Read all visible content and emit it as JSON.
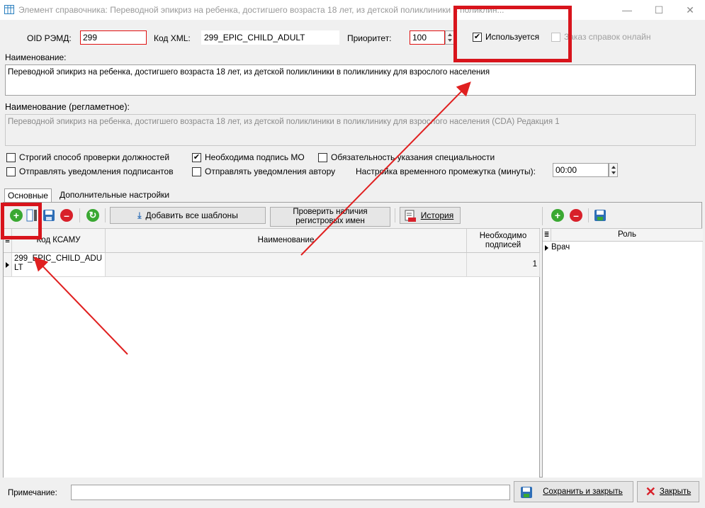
{
  "window": {
    "title": "Элемент справочника: Переводной эпикриз на ребенка, достигшего возраста 18 лет, из детской поликлиники в поликлин...",
    "minimize": "—",
    "maximize": "☐",
    "close": "✕"
  },
  "form": {
    "oid_label": "OID РЭМД:",
    "oid_value": "299",
    "xml_label": "Код XML:",
    "xml_value": "299_EPIC_CHILD_ADULT",
    "priority_label": "Приоритет:",
    "priority_value": "100",
    "used_label": "Используется",
    "used_checked": true,
    "order_online_label": "Заказ справок онлайн",
    "order_online_checked": false,
    "name_label": "Наименование:",
    "name_value": "Переводной эпикриз на ребенка, достигшего возраста 18 лет, из детской поликлиники в поликлинику для взрослого населения",
    "reg_name_label": "Наименование (регламетное):",
    "reg_name_value": "Переводной эпикриз на ребенка, достигшего возраста 18 лет, из детской поликлиники в поликлинику для взрослого населения (CDA) Редакция 1",
    "strict_check_label": "Строгий способ проверки должностей",
    "strict_check_checked": false,
    "mo_sign_label": "Необходима подпись МО",
    "mo_sign_checked": true,
    "specialty_label": "Обязательность указания специальности",
    "specialty_checked": false,
    "notify_signers_label": "Отправлять уведомления подписантов",
    "notify_signers_checked": false,
    "notify_author_label": "Отправлять уведомления автору",
    "notify_author_checked": false,
    "time_setting_label": "Настройка временного промежутка (минуты):",
    "time_setting_value": "00:00"
  },
  "tabs": [
    {
      "label": "Основные",
      "active": true
    },
    {
      "label": "Дополнительные настройки",
      "active": false
    }
  ],
  "toolbar": {
    "add_all_templates": "Добавить все шаблоны",
    "check_reg_names": "Проверить наличия регистровых имен",
    "history": "История"
  },
  "main_grid": {
    "columns": [
      "Код КСАМУ",
      "Наименование",
      "Необходимо подписей"
    ],
    "rows": [
      {
        "code": "299_EPIC_CHILD_ADULT",
        "name": "",
        "signatures": "1"
      }
    ]
  },
  "role_grid": {
    "columns": [
      "Роль"
    ],
    "rows": [
      {
        "role": "Врач"
      }
    ]
  },
  "footer": {
    "note_label": "Примечание:",
    "note_value": "",
    "save_close": "Сохранить и закрыть",
    "close": "Закрыть"
  },
  "colors": {
    "highlight": "#d8141c",
    "arrow": "#e02020",
    "add_green": "#3aa832",
    "remove_red": "#d8202a",
    "save_blue": "#2f6fb7"
  }
}
